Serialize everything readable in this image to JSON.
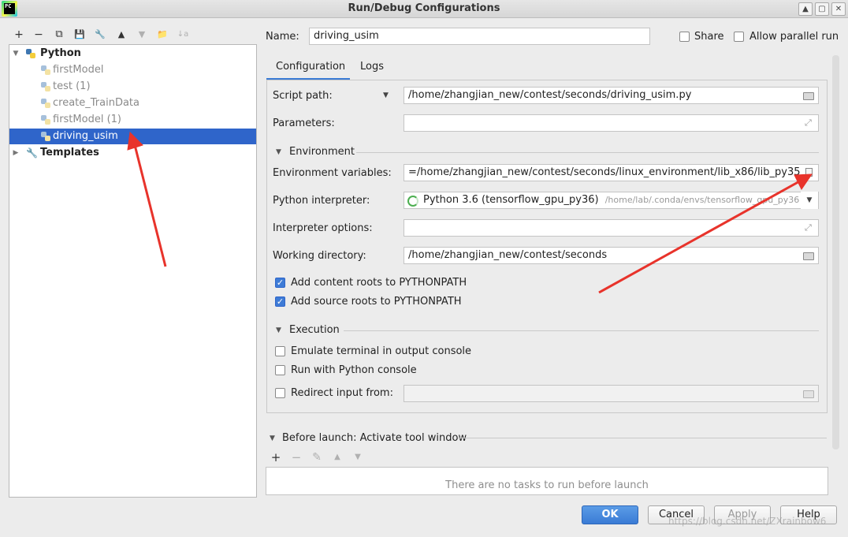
{
  "window": {
    "title": "Run/Debug Configurations",
    "logo_text": "PC",
    "buttons": [
      "▲",
      "▢",
      "✕"
    ]
  },
  "left_toolbar": [
    "+",
    "−",
    "⧉",
    "💾",
    "🔧",
    "▲",
    "▼",
    "📁",
    "↓a"
  ],
  "tree": {
    "items": [
      {
        "label": "Python",
        "level": 0,
        "expanded": true,
        "bold": true
      },
      {
        "label": "firstModel",
        "level": 1,
        "gray": true
      },
      {
        "label": "test (1)",
        "level": 1,
        "gray": true
      },
      {
        "label": "create_TrainData",
        "level": 1,
        "gray": true
      },
      {
        "label": "firstModel (1)",
        "level": 1,
        "gray": true
      },
      {
        "label": "driving_usim",
        "level": 1,
        "selected": true
      },
      {
        "label": "Templates",
        "level": 0,
        "expanded": false,
        "bold": true
      }
    ]
  },
  "name": {
    "label": "Name:",
    "value": "driving_usim"
  },
  "share": {
    "label": "Share",
    "checked": false
  },
  "parallel": {
    "label": "Allow parallel run",
    "checked": false
  },
  "tabs": {
    "configuration": "Configuration",
    "logs": "Logs"
  },
  "config": {
    "script_path": {
      "label": "Script path:",
      "value": "/home/zhangjian_new/contest/seconds/driving_usim.py"
    },
    "parameters": {
      "label": "Parameters:",
      "value": ""
    },
    "environment_section": "Environment",
    "env_vars": {
      "label": "Environment variables:",
      "value": "=/home/zhangjian_new/contest/seconds/linux_environment/lib_x86/lib_py35"
    },
    "interpreter": {
      "label": "Python interpreter:",
      "value": "Python 3.6 (tensorflow_gpu_py36)",
      "path": "/home/lab/.conda/envs/tensorflow_gpu_py36"
    },
    "interp_options": {
      "label": "Interpreter options:",
      "value": ""
    },
    "working_dir": {
      "label": "Working directory:",
      "value": "/home/zhangjian_new/contest/seconds"
    },
    "add_content_roots": {
      "label": "Add content roots to PYTHONPATH",
      "checked": true
    },
    "add_source_roots": {
      "label": "Add source roots to PYTHONPATH",
      "checked": true
    },
    "execution_section": "Execution",
    "emulate_terminal": {
      "label": "Emulate terminal in output console",
      "checked": false
    },
    "run_python_console": {
      "label": "Run with Python console",
      "checked": false
    },
    "redirect_input": {
      "label": "Redirect input from:",
      "checked": false,
      "value": ""
    }
  },
  "before_launch": {
    "title": "Before launch: Activate tool window",
    "empty_text": "There are no tasks to run before launch",
    "toolbar": [
      "+",
      "−",
      "✎",
      "▲",
      "▼"
    ]
  },
  "buttons": {
    "ok": "OK",
    "cancel": "Cancel",
    "apply": "Apply",
    "help": "Help"
  },
  "watermark": "https://blog.csdn.net/ZXrainbow6",
  "colors": {
    "selection": "#2f65ca",
    "arrow": "#e8332b",
    "ok_button": "#3a7bd5"
  }
}
